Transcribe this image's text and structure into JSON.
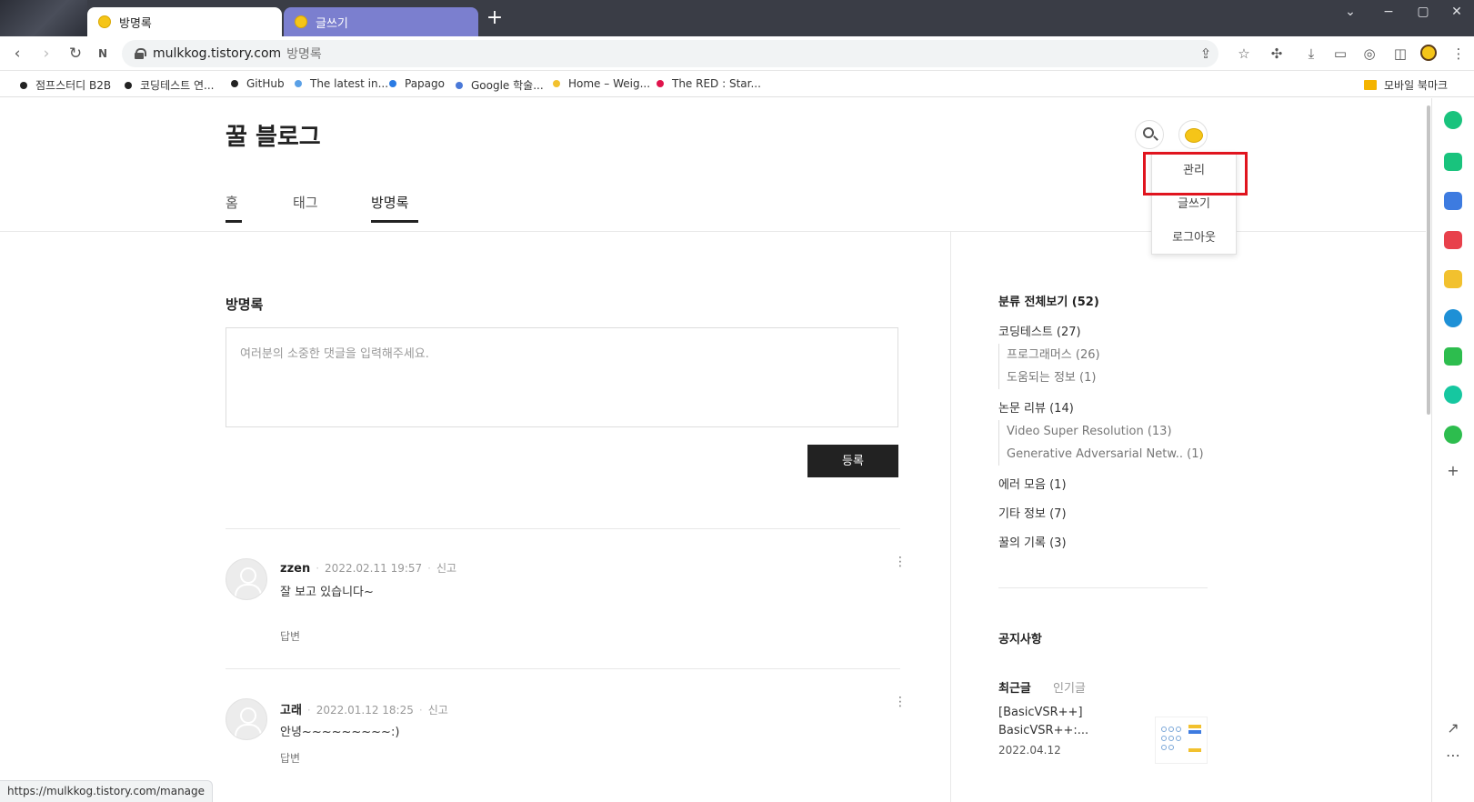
{
  "browser": {
    "tabs": [
      {
        "label": "방명록",
        "active": true
      },
      {
        "label": "글쓰기",
        "active": false
      }
    ],
    "url_domain": "mulkkog.tistory.com",
    "url_title": "방명록",
    "bookmarks": [
      {
        "label": "점프스터디 B2B",
        "color": "#222222"
      },
      {
        "label": "코딩테스트 연...",
        "color": "#222222"
      },
      {
        "label": "GitHub",
        "color": "#222222"
      },
      {
        "label": "The latest in...",
        "color": "#5aa0e6"
      },
      {
        "label": "Papago",
        "color": "#2a7be4"
      },
      {
        "label": "Google 학술...",
        "color": "#4a79d8"
      },
      {
        "label": "Home – Weig...",
        "color": "#f2c12e"
      },
      {
        "label": "The RED : Star...",
        "color": "#e0144c"
      }
    ],
    "mobile_bookmarks": "모바일 북마크",
    "status_url": "https://mulkkog.tistory.com/manage"
  },
  "blog": {
    "title": "꿀 블로그",
    "nav": [
      "홈",
      "태그",
      "방명록"
    ],
    "menu": [
      "관리",
      "글쓰기",
      "로그아웃"
    ]
  },
  "guestbook": {
    "title": "방명록",
    "placeholder": "여러분의 소중한 댓글을 입력해주세요.",
    "submit": "등록",
    "comments": [
      {
        "author": "zzen",
        "date": "2022.02.11 19:57",
        "report": "신고",
        "body": "잘 보고 있습니다~",
        "reply": "답변"
      },
      {
        "author": "고래",
        "date": "2022.01.12 18:25",
        "report": "신고",
        "body": "안녕~~~~~~~~~:)",
        "reply": "답변"
      }
    ]
  },
  "sidebar": {
    "all": "분류 전체보기 (52)",
    "categories": [
      {
        "label": "코딩테스트 (27)",
        "children": [
          "프로그래머스 (26)",
          "도움되는 정보 (1)"
        ]
      },
      {
        "label": "논문 리뷰 (14)",
        "children": [
          "Video Super Resolution (13)",
          "Generative Adversarial Netw.. (1)"
        ]
      },
      {
        "label": "에러 모음 (1)",
        "children": []
      },
      {
        "label": "기타 정보 (7)",
        "children": []
      },
      {
        "label": "꿀의 기록 (3)",
        "children": []
      }
    ],
    "notice": "공지사항",
    "tabs": [
      "최근글",
      "인기글"
    ],
    "recent_post": {
      "title_line1": "[BasicVSR++]",
      "title_line2": "BasicVSR++:...",
      "date": "2022.04.12"
    }
  },
  "colors": {
    "highlight": "#e0141e",
    "accent_dark": "#222222"
  }
}
